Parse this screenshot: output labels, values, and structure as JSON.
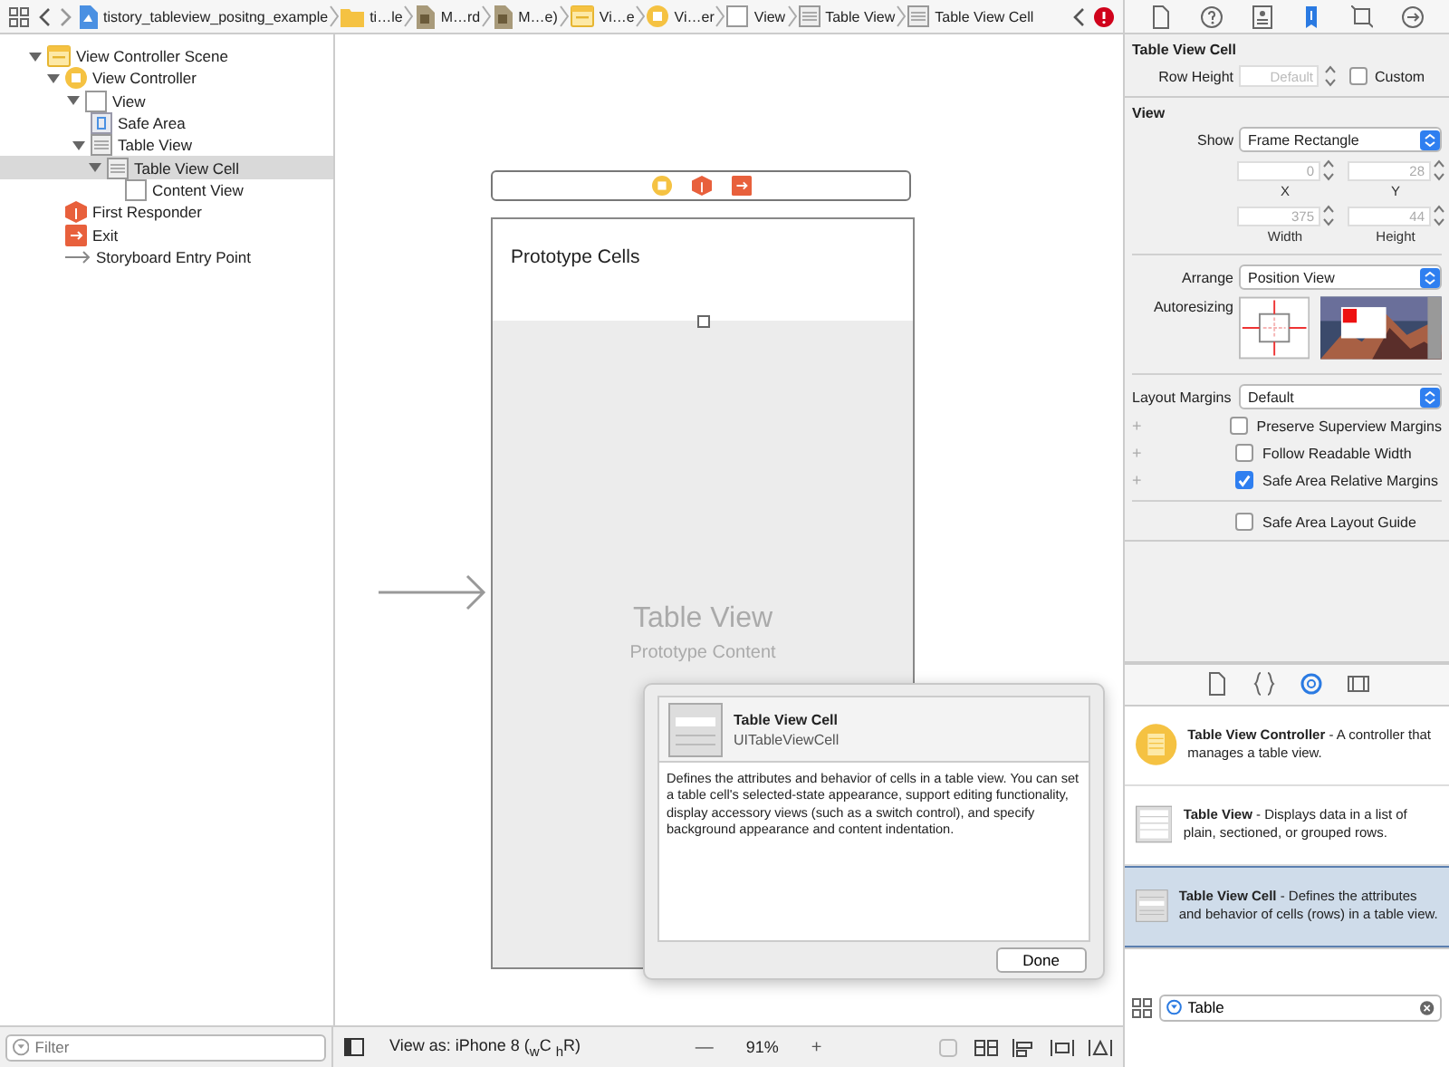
{
  "breadcrumbs": [
    {
      "kind": "project",
      "label": "tistory_tableview_positng_example"
    },
    {
      "kind": "folder",
      "label": "ti…le"
    },
    {
      "kind": "storyboard",
      "label": "M…rd"
    },
    {
      "kind": "storyboard",
      "label": "M…e)"
    },
    {
      "kind": "scene",
      "label": "Vi…e"
    },
    {
      "kind": "controller",
      "label": "Vi…er"
    },
    {
      "kind": "view",
      "label": "View"
    },
    {
      "kind": "table",
      "label": "Table View"
    },
    {
      "kind": "cell",
      "label": "Table View Cell"
    }
  ],
  "outline": [
    {
      "kind": "scene",
      "label": "View Controller Scene",
      "expanded": true,
      "selected": false,
      "children": [
        {
          "kind": "controller",
          "label": "View Controller",
          "expanded": true,
          "selected": false,
          "children": [
            {
              "kind": "view",
              "label": "View",
              "expanded": true,
              "selected": false,
              "children": [
                {
                  "kind": "safe-area",
                  "label": "Safe Area",
                  "selected": false
                },
                {
                  "kind": "table",
                  "label": "Table View",
                  "expanded": true,
                  "selected": false,
                  "children": [
                    {
                      "kind": "cell",
                      "label": "Table View Cell",
                      "expanded": true,
                      "selected": true,
                      "children": [
                        {
                          "kind": "view",
                          "label": "Content View",
                          "selected": false
                        }
                      ]
                    }
                  ]
                }
              ]
            }
          ]
        },
        {
          "kind": "responder",
          "label": "First Responder",
          "selected": false
        },
        {
          "kind": "exit",
          "label": "Exit",
          "selected": false
        },
        {
          "kind": "entry",
          "label": "Storyboard Entry Point",
          "selected": false
        }
      ]
    }
  ],
  "filter": {
    "placeholder": "Filter"
  },
  "canvas": {
    "header": "Prototype Cells",
    "table_label": "Table View",
    "content_label": "Prototype Content"
  },
  "popover": {
    "title": "Table View Cell",
    "class_name": "UITableViewCell",
    "description": "Defines the attributes and behavior of cells in a table view. You can set a table cell's selected-state appearance, support editing functionality, display accessory views (such as a switch control), and specify background appearance and content indentation.",
    "button": "Done"
  },
  "canvas_bar": {
    "view_as": "View as: iPhone 8 ($_{w}$C $_{h}$R)",
    "zoom_out": "—",
    "zoom": "91%",
    "zoom_in": "+"
  },
  "inspector_tabs": [
    {
      "kind": "file",
      "selected": false
    },
    {
      "kind": "help",
      "selected": false
    },
    {
      "kind": "identity",
      "selected": false
    },
    {
      "kind": "attributes",
      "selected": true
    },
    {
      "kind": "size",
      "selected": false
    },
    {
      "kind": "connections",
      "selected": false
    }
  ],
  "inspector": {
    "title": "Table View Cell",
    "row_height": {
      "label": "Row Height",
      "placeholder": "Default"
    },
    "custom": {
      "label": "Custom",
      "checked": false
    },
    "view_title": "View",
    "show": {
      "label": "Show",
      "value": "Frame Rectangle"
    },
    "frame": [
      {
        "label": "X",
        "value": "0",
        "disabled": true
      },
      {
        "label": "Y",
        "value": "28",
        "disabled": true
      },
      {
        "label": "Width",
        "value": "375",
        "disabled": true
      },
      {
        "label": "Height",
        "value": "44",
        "disabled": true
      }
    ],
    "arrange": {
      "label": "Arrange",
      "value": "Position View"
    },
    "autoresizing": "Autoresizing",
    "layout_margins": {
      "label": "Layout Margins",
      "value": "Default"
    },
    "options": [
      {
        "prefix": "+",
        "label": "Preserve Superview Margins",
        "checked": false
      },
      {
        "prefix": "+",
        "label": "Follow Readable Width",
        "checked": false
      },
      {
        "prefix": "+",
        "label": "Safe Area Relative Margins",
        "checked": true
      },
      {
        "label": "Safe Area Layout Guide",
        "checked": false
      }
    ]
  },
  "library_tabs": [
    {
      "kind": "file",
      "selected": false
    },
    {
      "kind": "braces",
      "selected": false
    },
    {
      "kind": "object",
      "selected": true
    },
    {
      "kind": "media",
      "selected": false
    }
  ],
  "library": [
    {
      "kind": "controller",
      "text": "**Table View Controller** - A controller that manages a table view.",
      "selected": false
    },
    {
      "kind": "table",
      "text": "**Table View** - Displays data in a list of plain, sectioned, or grouped rows.",
      "selected": false
    },
    {
      "kind": "cell",
      "text": "**Table View Cell** - Defines the attributes and behavior of cells (rows) in a table view.",
      "selected": true
    }
  ],
  "search": {
    "value": "Table"
  }
}
